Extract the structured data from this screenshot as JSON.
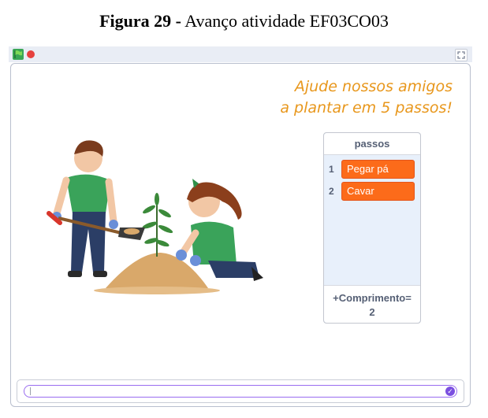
{
  "caption": {
    "bold": "Figura 29 -",
    "rest": "Avanço atividade EF03CO03"
  },
  "topbar": {
    "flag_icon": "green-flag-icon",
    "stop_icon": "stop-icon",
    "fullscreen_icon": "fullscreen-icon"
  },
  "stage": {
    "title_line1": "Ajude nossos amigos",
    "title_line2": "a plantar em 5 passos!",
    "illustration_icon": "children-planting-tree-illustration"
  },
  "list_monitor": {
    "header": "passos",
    "items": [
      {
        "index": "1",
        "value": "Pegar pá"
      },
      {
        "index": "2",
        "value": "Cavar"
      }
    ],
    "footer_label": "+Comprimento=",
    "footer_value": "2"
  },
  "ask_prompt": {
    "value": "",
    "submit_icon": "check-icon"
  },
  "colors": {
    "title": "#e8971c",
    "list_item": "#fc6b1a",
    "ask_border": "#9a6df0"
  }
}
